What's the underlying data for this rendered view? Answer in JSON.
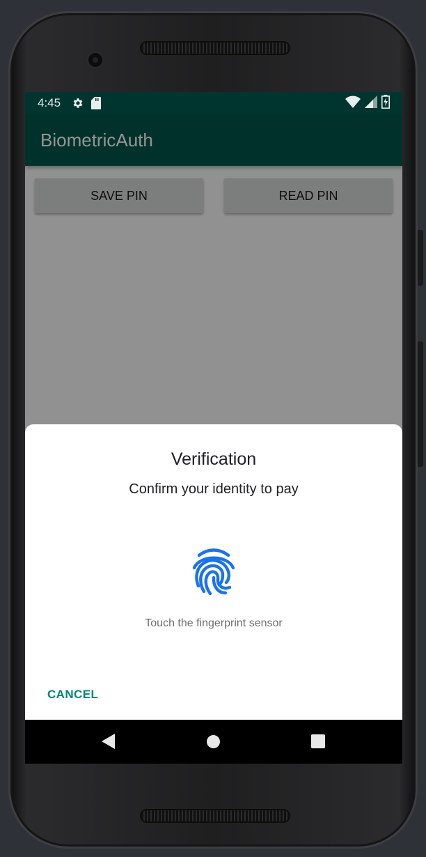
{
  "status_bar": {
    "time": "4:45",
    "icons": [
      "gear-icon",
      "sd-card-icon",
      "wifi-icon",
      "cell-signal-icon",
      "battery-charging-icon"
    ]
  },
  "app_bar": {
    "title": "BiometricAuth"
  },
  "buttons": {
    "save_pin": "SAVE PIN",
    "read_pin": "READ PIN"
  },
  "dialog": {
    "title": "Verification",
    "subtitle": "Confirm your identity to pay",
    "icon": "fingerprint-icon",
    "status": "Touch the fingerprint sensor",
    "cancel": "CANCEL"
  },
  "nav_bar": {
    "icons": [
      "back-icon",
      "home-icon",
      "recents-icon"
    ]
  },
  "colors": {
    "primary": "#00574b",
    "primary_dark": "#00352f",
    "accent": "#008577",
    "fingerprint": "#1a73e8"
  }
}
